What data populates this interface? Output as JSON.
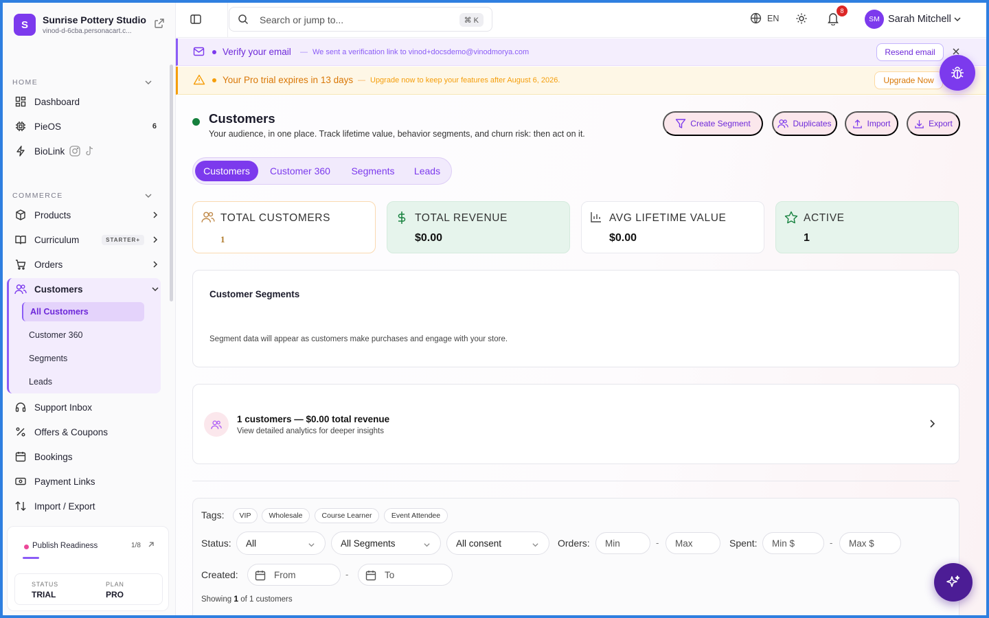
{
  "brand": {
    "initial": "S",
    "name": "Sunrise Pottery Studio",
    "url": "vinod-d-6cba.personacart.c..."
  },
  "sidebar": {
    "sections": {
      "home": "HOME",
      "commerce": "COMMERCE"
    },
    "home_items": [
      {
        "label": "Dashboard",
        "icon": "dashboard-icon"
      },
      {
        "label": "PieOS",
        "icon": "chip-icon",
        "count": "6"
      },
      {
        "label": "BioLink",
        "icon": "lightning-icon"
      }
    ],
    "commerce_items": [
      {
        "label": "Products",
        "icon": "box-icon"
      },
      {
        "label": "Curriculum",
        "icon": "book-icon",
        "badge": "STARTER+"
      },
      {
        "label": "Orders",
        "icon": "cart-icon"
      },
      {
        "label": "Customers",
        "icon": "users-icon"
      }
    ],
    "customers_sub": [
      {
        "label": "All Customers",
        "active": true
      },
      {
        "label": "Customer 360"
      },
      {
        "label": "Segments"
      },
      {
        "label": "Leads"
      }
    ],
    "other_items": [
      {
        "label": "Support Inbox",
        "icon": "headset-icon"
      },
      {
        "label": "Offers & Coupons",
        "icon": "percent-icon"
      },
      {
        "label": "Bookings",
        "icon": "calendar-icon"
      },
      {
        "label": "Payment Links",
        "icon": "payment-icon"
      },
      {
        "label": "Import / Export",
        "icon": "import-export-icon"
      }
    ],
    "publish": {
      "title": "Publish Readiness",
      "progress": "1/8",
      "status_label": "STATUS",
      "status_value": "TRIAL",
      "plan_label": "PLAN",
      "plan_value": "PRO"
    }
  },
  "topbar": {
    "search_placeholder": "Search or jump to...",
    "shortcut": "⌘ K",
    "language": "EN",
    "notifications": "8",
    "user_initials": "SM",
    "user_name": "Sarah Mitchell"
  },
  "banners": {
    "verify": {
      "title": "Verify your email",
      "separator": "—",
      "message": "We sent a verification link to vinod+docsdemo@vinodmorya.com",
      "button": "Resend email"
    },
    "trial": {
      "title": "Your Pro trial expires in 13 days",
      "separator": "—",
      "message": "Upgrade now to keep your features after August 6, 2026.",
      "button": "Upgrade Now"
    }
  },
  "page": {
    "title": "Customers",
    "subtitle": "Your audience, in one place. Track lifetime value, behavior segments, and churn risk: then act on it.",
    "actions": [
      "Create Segment",
      "Duplicates",
      "Import",
      "Export"
    ],
    "tabs": [
      "Customers",
      "Customer 360",
      "Segments",
      "Leads"
    ],
    "stats": [
      {
        "label": "TOTAL CUSTOMERS",
        "value": "1"
      },
      {
        "label": "TOTAL REVENUE",
        "value": "$0.00"
      },
      {
        "label": "AVG LIFETIME VALUE",
        "value": "$0.00"
      },
      {
        "label": "ACTIVE",
        "value": "1"
      }
    ],
    "segments": {
      "title": "Customer Segments",
      "empty": "Segment data will appear as customers make purchases and engage with your store."
    },
    "summary": {
      "title": "1 customers — $0.00 total revenue",
      "subtitle": "View detailed analytics for deeper insights"
    }
  },
  "filters": {
    "tags_label": "Tags:",
    "tags": [
      "VIP",
      "Wholesale",
      "Course Learner",
      "Event Attendee"
    ],
    "status_label": "Status:",
    "status_value": "All",
    "segment_value": "All Segments",
    "consent_value": "All consent",
    "orders_label": "Orders:",
    "orders_min": "Min",
    "orders_max": "Max",
    "spent_label": "Spent:",
    "spent_min": "Min $",
    "spent_max": "Max $",
    "range_sep": "-",
    "created_label": "Created:",
    "from": "From",
    "to": "To",
    "showing_pre": "Showing",
    "showing_count": "1",
    "showing_post": "of 1 customers"
  },
  "colors": {
    "accent": "#7c3aed",
    "success": "#15803d",
    "warning": "#f59e0b",
    "danger": "#dc2626"
  }
}
